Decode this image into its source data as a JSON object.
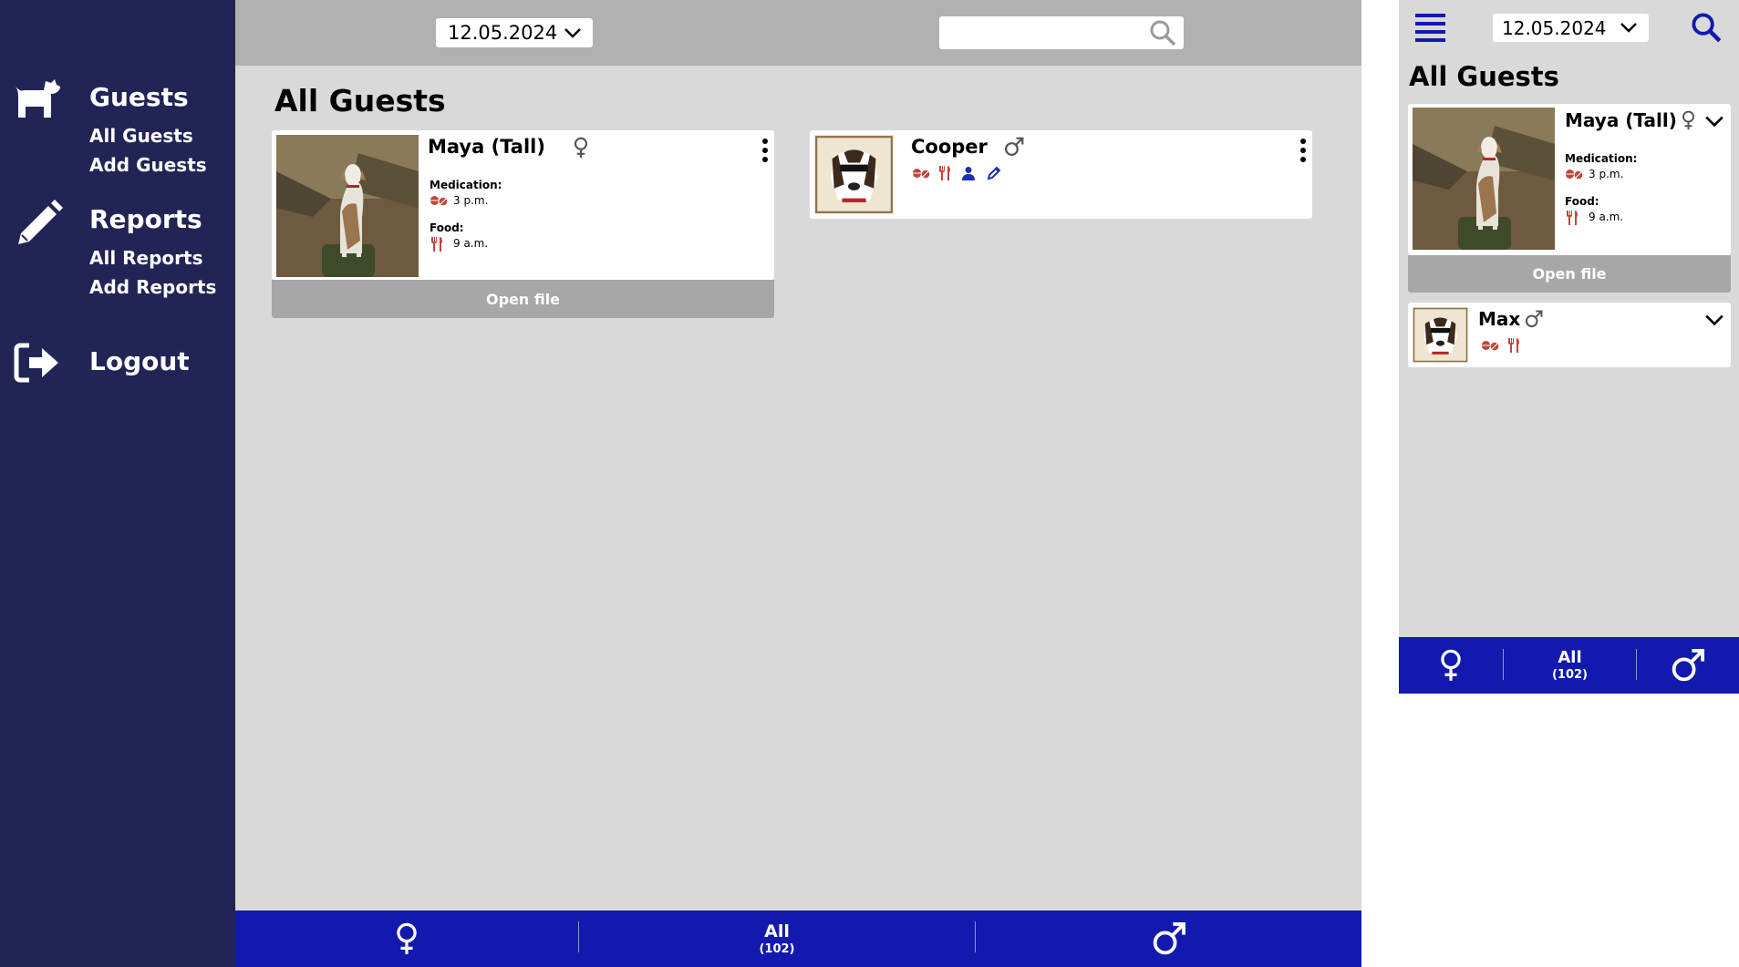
{
  "sidebar": {
    "guests": {
      "title": "Guests",
      "items": [
        "All Guests",
        "Add Guests"
      ]
    },
    "reports": {
      "title": "Reports",
      "items": [
        "All Reports",
        "Add Reports"
      ]
    },
    "logout": "Logout"
  },
  "topbar": {
    "date": "12.05.2024",
    "search_placeholder": ""
  },
  "main": {
    "title": "All Guests",
    "cards": [
      {
        "name": "Maya (Tall)",
        "gender": "female",
        "medication_label": "Medication:",
        "medication_time": "3 p.m.",
        "food_label": "Food:",
        "food_time": "9 a.m.",
        "open_file": "Open file"
      },
      {
        "name": "Cooper",
        "gender": "male",
        "icons": [
          "pills-icon",
          "fork-knife-icon",
          "person-icon",
          "pencil-icon"
        ]
      }
    ]
  },
  "filter_bar": {
    "all_label": "All",
    "all_count": "(102)"
  },
  "mobile": {
    "date": "12.05.2024",
    "title": "All Guests",
    "cards": [
      {
        "name": "Maya (Tall)",
        "gender": "female",
        "medication_label": "Medication:",
        "medication_time": "3 p.m.",
        "food_label": "Food:",
        "food_time": "9 a.m.",
        "open_file": "Open file"
      },
      {
        "name": "Max",
        "gender": "male",
        "icons": [
          "pills-icon",
          "fork-knife-icon"
        ]
      }
    ],
    "filter_bar": {
      "all_label": "All",
      "all_count": "(102)"
    }
  },
  "colors": {
    "sidebar": "#232456",
    "accent": "#1319ad",
    "topbar": "#b1b1b1",
    "canvas": "#d9d9d9",
    "icon_red": "#c0463c",
    "icon_blue": "#1a2fb8"
  }
}
